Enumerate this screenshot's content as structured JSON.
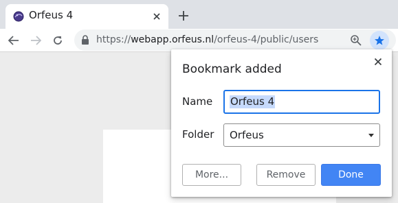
{
  "tab": {
    "title": "Orfeus 4",
    "favicon": "orfeus-logo-icon"
  },
  "toolbar": {
    "url_scheme": "https://",
    "url_host": "webapp.orfeus.nl",
    "url_path": "/orfeus-4/public/users"
  },
  "bookmark_bubble": {
    "title": "Bookmark added",
    "name_label": "Name",
    "name_value": "Orfeus 4",
    "folder_label": "Folder",
    "folder_value": "Orfeus",
    "more_label": "More...",
    "remove_label": "Remove",
    "done_label": "Done"
  },
  "colors": {
    "accent": "#4285f4",
    "star_active_bg": "#d2e3fc",
    "input_focus": "#1a73e8",
    "text_selection": "#c6dafc"
  }
}
